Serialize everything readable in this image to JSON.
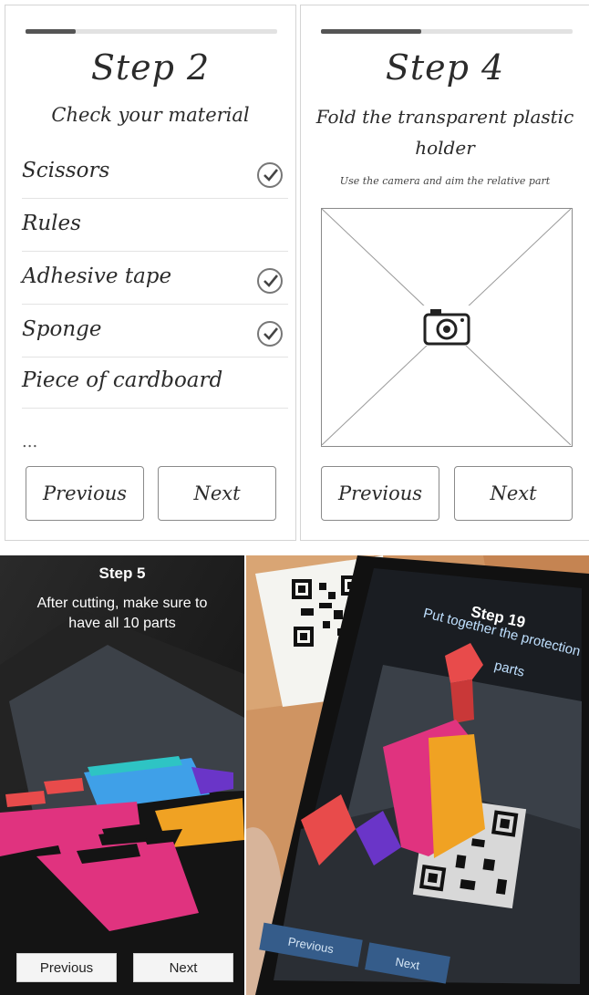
{
  "step2": {
    "title": "Step 2",
    "subtitle": "Check your material",
    "progress": 0.2,
    "materials": [
      {
        "label": "Scissors",
        "checked": true
      },
      {
        "label": "Rules",
        "checked": false
      },
      {
        "label": "Adhesive tape",
        "checked": true
      },
      {
        "label": "Sponge",
        "checked": true
      },
      {
        "label": "Piece of cardboard",
        "checked": false
      }
    ],
    "ellipsis": "...",
    "previous_label": "Previous",
    "next_label": "Next"
  },
  "step4": {
    "title": "Step 4",
    "subtitle_line1": "Fold the transparent plastic",
    "subtitle_line2": "holder",
    "hint": "Use the camera and aim the relative part",
    "progress": 0.4,
    "camera_icon": "camera-icon",
    "previous_label": "Previous",
    "next_label": "Next"
  },
  "step5": {
    "title": "Step 5",
    "instruction_line1": "After cutting, make sure to",
    "instruction_line2": "have all 10 parts",
    "previous_label": "Previous",
    "next_label": "Next"
  },
  "step19": {
    "title": "Step 19",
    "instruction_line1": "Put together the protection",
    "instruction_line2": "parts",
    "previous_label": "Previous",
    "next_label": "Next"
  },
  "colors": {
    "pink": "#e0337f",
    "blue": "#3fa0e8",
    "orange": "#f0a223",
    "teal": "#2ec4c4",
    "purple": "#6a35c8",
    "red": "#e84b4b",
    "wire_ink": "#2b2b2b"
  }
}
